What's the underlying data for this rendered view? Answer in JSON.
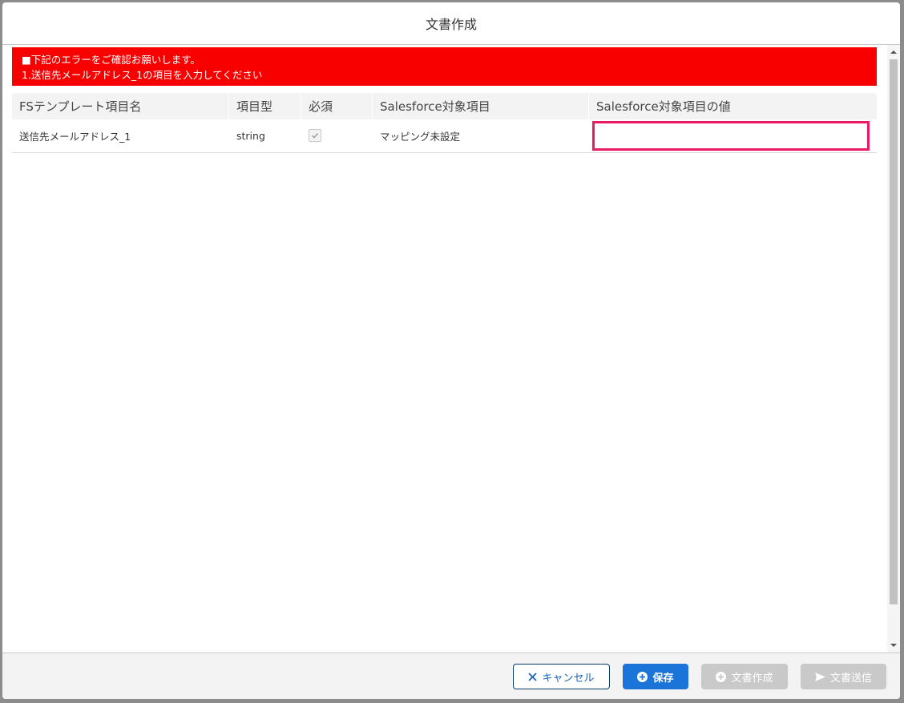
{
  "modal": {
    "title": "文書作成"
  },
  "error": {
    "line1": "■下記のエラーをご確認お願いします。",
    "line2": "1.送信先メールアドレス_1の項目を入力してください"
  },
  "table": {
    "headers": [
      "FSテンプレート項目名",
      "項目型",
      "必須",
      "Salesforce対象項目",
      "Salesforce対象項目の値"
    ],
    "rows": [
      {
        "field_name": "送信先メールアドレス_1",
        "type": "string",
        "required": true,
        "sf_field": "マッピング未設定",
        "sf_value": ""
      }
    ]
  },
  "footer": {
    "cancel_label": "キャンセル",
    "save_label": "保存",
    "create_label": "文書作成",
    "send_label": "文書送信"
  },
  "colors": {
    "error_bg": "#f80000",
    "highlight_border": "#ea1a66",
    "primary": "#1b74d8",
    "disabled": "#c9c9c9"
  },
  "icons": {
    "cancel": "close-icon",
    "save": "add-circle-icon",
    "create": "add-circle-icon",
    "send": "send-icon",
    "required": "check-icon"
  }
}
